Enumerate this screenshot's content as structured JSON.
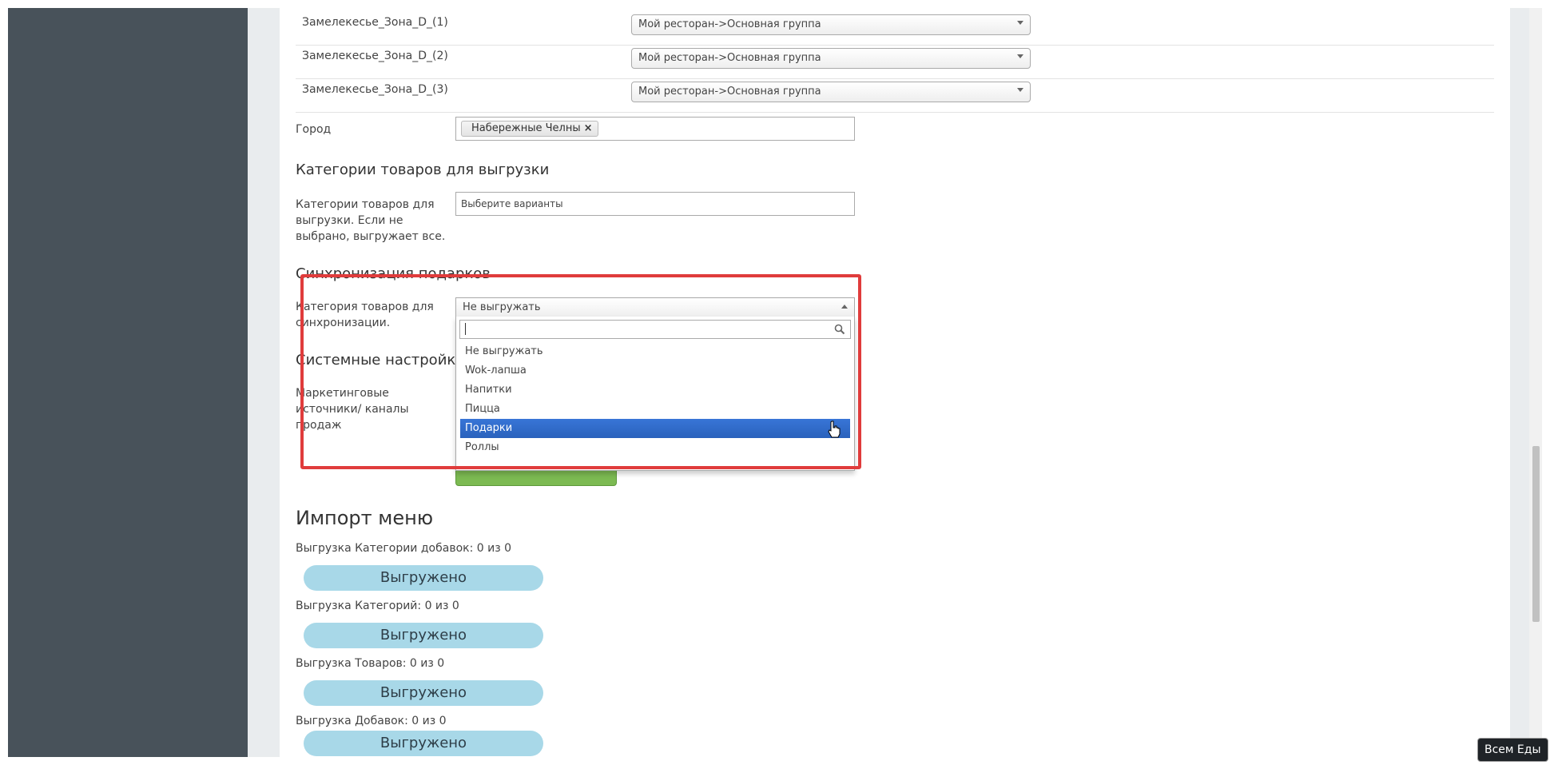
{
  "zones": [
    {
      "label": "Замелекесье_Зона_D_(1)",
      "value": "Мой ресторан->Основная группа"
    },
    {
      "label": "Замелекесье_Зона_D_(2)",
      "value": "Мой ресторан->Основная группа"
    },
    {
      "label": "Замелекесье_Зона_D_(3)",
      "value": "Мой ресторан->Основная группа"
    }
  ],
  "city": {
    "label": "Город",
    "tag": "Набережные Челны",
    "remove": "×"
  },
  "categories": {
    "section_title": "Категории товаров для выгрузки",
    "label": [
      "Категории товаров для",
      "выгрузки. Если не",
      "выбрано, выгружает все."
    ],
    "placeholder": "Выберите варианты"
  },
  "gifts": {
    "section_title": "Синхронизация подарков",
    "label": [
      "Категория товаров для",
      "синхронизации."
    ],
    "selected": "Не выгружать",
    "options": [
      "Не выгружать",
      "Wok-лапша",
      "Напитки",
      "Пицца",
      "Подарки",
      "Роллы"
    ],
    "highlighted_index": 4
  },
  "system": {
    "section_title": "Системные настройк",
    "label": [
      "Маркетинговые",
      "источники/ каналы",
      "продаж"
    ]
  },
  "import": {
    "title": "Импорт меню",
    "rows": [
      {
        "label": "Выгрузка Категории добавок: 0 из 0",
        "status": "Выгружено"
      },
      {
        "label": "Выгрузка Категорий: 0 из 0",
        "status": "Выгружено"
      },
      {
        "label": "Выгрузка Товаров: 0 из 0",
        "status": "Выгружено"
      },
      {
        "label": "Выгрузка Добавок: 0 из 0",
        "status": "Выгружено"
      }
    ]
  },
  "brand_badge": "Всем Еды",
  "colors": {
    "sidebar": "#48525a",
    "highlight": "#3875d7",
    "annotation": "#e03c3c",
    "progress": "#a8d8e8"
  }
}
